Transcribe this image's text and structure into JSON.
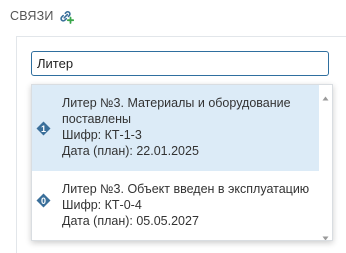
{
  "section": {
    "title": "СВЯЗИ",
    "add_link_icon": "link-add-icon"
  },
  "search": {
    "value": "Литер"
  },
  "dropdown": {
    "options": [
      {
        "title": "Литер №3. Материалы и оборудование поставлены",
        "code": "Шифр: КТ-1-3",
        "date": "Дата (план): 22.01.2025",
        "badge": "1",
        "badge_color": "#3a6f9a",
        "highlighted": true
      },
      {
        "title": "Литер №3. Объект введен в эксплуатацию",
        "code": "Шифр: КТ-0-4",
        "date": "Дата (план): 05.05.2027",
        "badge": "0",
        "badge_color": "#3a6f9a",
        "highlighted": false
      }
    ]
  },
  "colors": {
    "accent": "#2f6f9f",
    "highlight_bg": "#dcebf7",
    "link_icon_green": "#3aa64a",
    "link_icon_blue": "#3a6f9a"
  }
}
